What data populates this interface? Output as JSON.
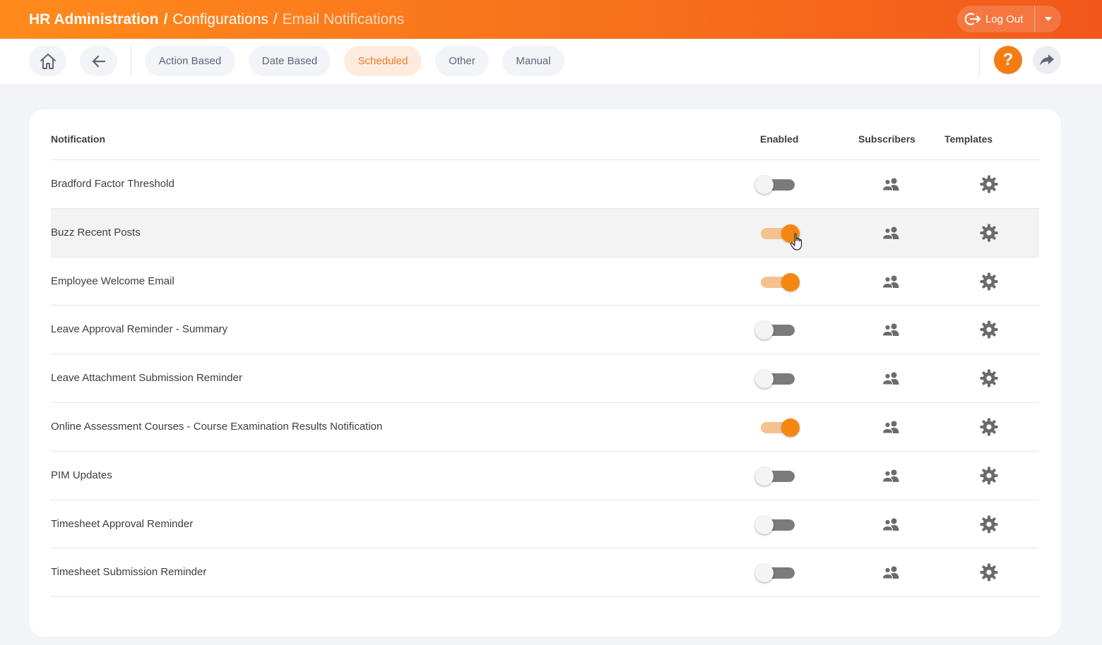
{
  "header": {
    "breadcrumb": {
      "module": "HR Administration",
      "separator": "/",
      "level": "Configurations",
      "current": "Email Notifications"
    },
    "logout_label": "Log Out",
    "logout_icon": "logout-icon",
    "dropdown_icon": "caret-down-icon",
    "accent_color": "#f57c13"
  },
  "nav": {
    "home_icon": "home-icon",
    "back_icon": "arrow-left-icon",
    "tabs": [
      {
        "label": "Action Based",
        "active": false
      },
      {
        "label": "Date Based",
        "active": false
      },
      {
        "label": "Scheduled",
        "active": true
      },
      {
        "label": "Other",
        "active": false
      },
      {
        "label": "Manual",
        "active": false
      }
    ],
    "help_label": "?",
    "share_icon": "share-arrow-icon"
  },
  "table": {
    "columns": {
      "notification": "Notification",
      "enabled": "Enabled",
      "subscribers": "Subscribers",
      "templates": "Templates"
    },
    "rows": [
      {
        "name": "Bradford Factor Threshold",
        "enabled": false
      },
      {
        "name": "Buzz Recent Posts",
        "enabled": true
      },
      {
        "name": "Employee Welcome Email",
        "enabled": true
      },
      {
        "name": "Leave Approval Reminder - Summary",
        "enabled": false
      },
      {
        "name": "Leave Attachment Submission Reminder",
        "enabled": false
      },
      {
        "name": "Online Assessment Courses - Course Examination Results Notification",
        "enabled": true
      },
      {
        "name": "PIM Updates",
        "enabled": false
      },
      {
        "name": "Timesheet Approval Reminder",
        "enabled": false
      },
      {
        "name": "Timesheet Submission Reminder",
        "enabled": false
      }
    ],
    "hovered_row": "Buzz Recent Posts",
    "subscribers_icon": "users-icon",
    "templates_icon": "gear-icon"
  }
}
